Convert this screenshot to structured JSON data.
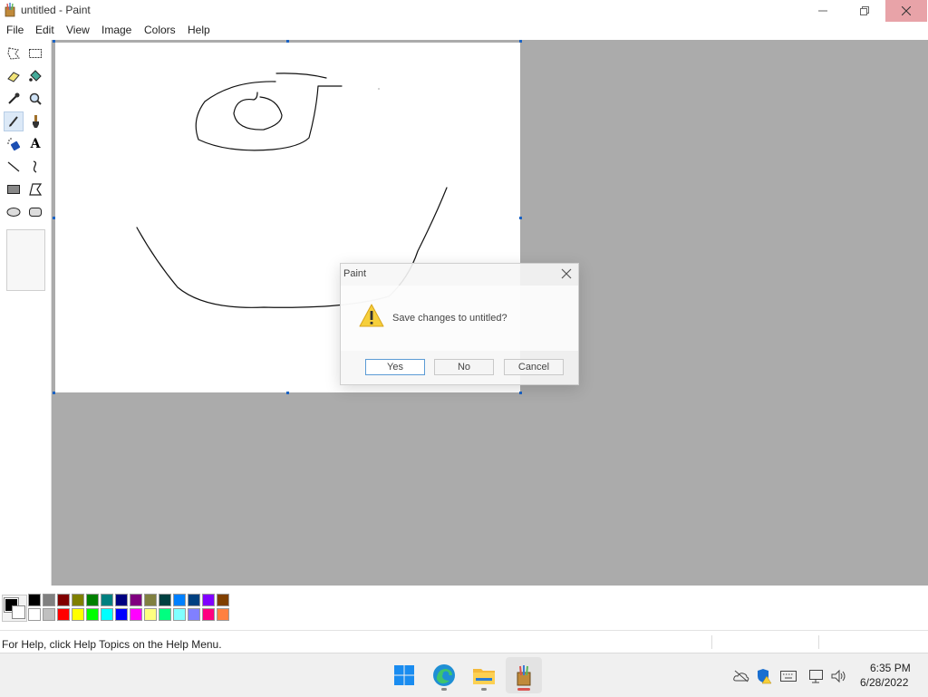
{
  "window": {
    "title": "untitled - Paint"
  },
  "menu": {
    "items": [
      "File",
      "Edit",
      "View",
      "Image",
      "Colors",
      "Help"
    ]
  },
  "toolbox": {
    "tools": [
      {
        "name": "free-form-select-icon"
      },
      {
        "name": "rect-select-icon"
      },
      {
        "name": "eraser-icon"
      },
      {
        "name": "fill-icon"
      },
      {
        "name": "color-picker-icon"
      },
      {
        "name": "magnifier-icon"
      },
      {
        "name": "pencil-icon"
      },
      {
        "name": "brush-icon"
      },
      {
        "name": "airbrush-icon"
      },
      {
        "name": "text-icon",
        "glyph": "A"
      },
      {
        "name": "line-icon"
      },
      {
        "name": "curve-icon"
      },
      {
        "name": "rectangle-icon"
      },
      {
        "name": "polygon-icon"
      },
      {
        "name": "ellipse-icon"
      },
      {
        "name": "rounded-rect-icon"
      }
    ],
    "selected": "pencil-icon"
  },
  "palette": {
    "foreground": "#000000",
    "background": "#ffffff",
    "row1": [
      "#000000",
      "#808080",
      "#800000",
      "#808000",
      "#008000",
      "#008080",
      "#000080",
      "#800080",
      "#808040",
      "#004040",
      "#0080ff",
      "#004080",
      "#8000ff",
      "#804000"
    ],
    "row2": [
      "#ffffff",
      "#c0c0c0",
      "#ff0000",
      "#ffff00",
      "#00ff00",
      "#00ffff",
      "#0000ff",
      "#ff00ff",
      "#ffff80",
      "#00ff80",
      "#80ffff",
      "#8080ff",
      "#ff0080",
      "#ff8040"
    ]
  },
  "status": {
    "text": "For Help, click Help Topics on the Help Menu."
  },
  "dialog": {
    "title": "Paint",
    "message": "Save changes to untitled?",
    "buttons": {
      "yes": "Yes",
      "no": "No",
      "cancel": "Cancel"
    }
  },
  "taskbar": {
    "apps": [
      "start-icon",
      "edge-icon",
      "file-explorer-icon",
      "paint-app-icon"
    ],
    "active": "paint-app-icon",
    "tray": [
      "onedrive-icon",
      "security-icon",
      "keyboard-icon",
      "network-icon",
      "volume-icon"
    ],
    "time": "6:35 PM",
    "date": "6/28/2022"
  },
  "colors": {
    "workspace": "#ababab",
    "close_hover": "#e8a3a8",
    "selection_handle": "#1b63c4"
  }
}
